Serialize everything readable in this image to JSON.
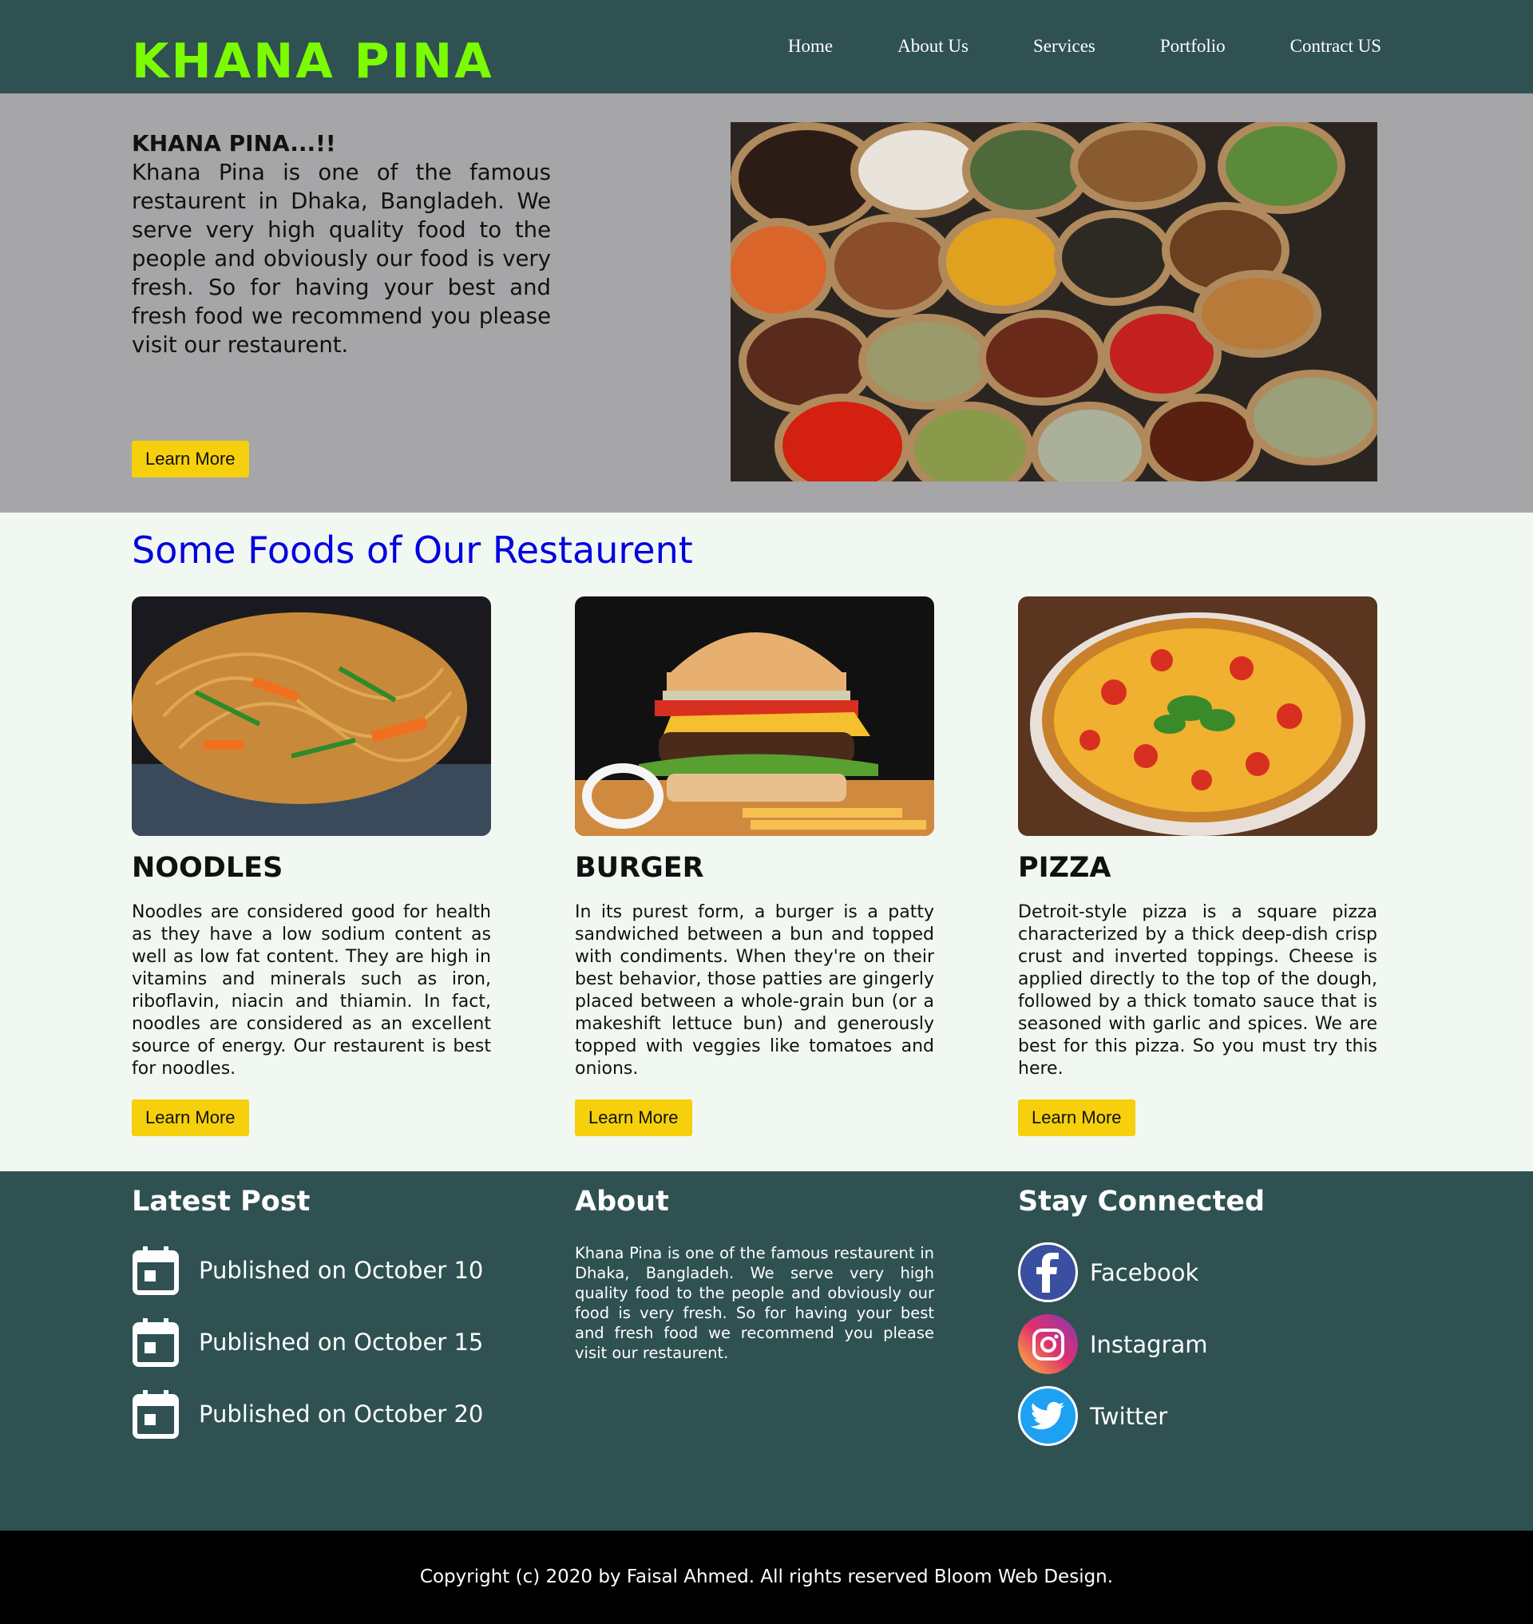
{
  "header": {
    "logo": "KHANA PINA",
    "nav": [
      "Home",
      "About Us",
      "Services",
      "Portfolio",
      "Contract US"
    ]
  },
  "hero": {
    "title": "KHANA PINA...!!",
    "text": "Khana Pina is one of the famous restaurent in Dhaka, Bangladeh. We serve very high quality food to the people and obviously our food is very fresh. So for having your best and fresh food we recommend you please visit our restaurent.",
    "button": "Learn More"
  },
  "foods": {
    "title": "Some Foods of Our Restaurent",
    "cards": [
      {
        "title": "NOODLES",
        "text": "Noodles are considered good for health as they have a low sodium content as well as low fat content. They are high in vitamins and minerals such as iron, riboflavin, niacin and thiamin. In fact, noodles are considered as an excellent source of energy. Our restaurent is best for noodles.",
        "button": "Learn More"
      },
      {
        "title": "BURGER",
        "text": "In its purest form, a burger is a patty sandwiched between a bun and topped with condiments. When they're on their best behavior, those patties are gingerly placed between a whole-grain bun (or a makeshift lettuce bun) and generously topped with veggies like tomatoes and onions.",
        "button": "Learn More"
      },
      {
        "title": "PIZZA",
        "text": "Detroit-style pizza is a square pizza characterized by a thick deep-dish crisp crust and inverted toppings. Cheese is applied directly to the top of the dough, followed by a thick tomato sauce that is seasoned with garlic and spices. We are best for this pizza. So you must try this here.",
        "button": "Learn More"
      }
    ]
  },
  "footer": {
    "latest_post": {
      "title": "Latest Post",
      "posts": [
        "Published on October 10",
        "Published on October 15",
        "Published on October 20"
      ]
    },
    "about": {
      "title": "About",
      "text": "Khana Pina is one of the famous restaurent in Dhaka, Bangladeh. We serve very high quality food to the people and obviously our food is very fresh. So for having your best and fresh food we recommend you please visit our restaurent."
    },
    "social": {
      "title": "Stay Connected",
      "items": [
        "Facebook",
        "Instagram",
        "Twitter"
      ]
    }
  },
  "copyright": "Copyright (c) 2020 by Faisal Ahmed. All rights reserved Bloom Web Design.",
  "colors": {
    "header_bg": "#2f5152",
    "logo": "#7cfc00",
    "hero_bg": "#a6a5a7",
    "section_bg": "#f1f8f1",
    "heading_blue": "#0000e0",
    "button": "#f6d00c",
    "footer_bg": "#2f5152",
    "copyright_bg": "#000000"
  },
  "icons": {
    "post": "calendar-icon",
    "social": [
      "facebook-icon",
      "instagram-icon",
      "twitter-icon"
    ]
  }
}
